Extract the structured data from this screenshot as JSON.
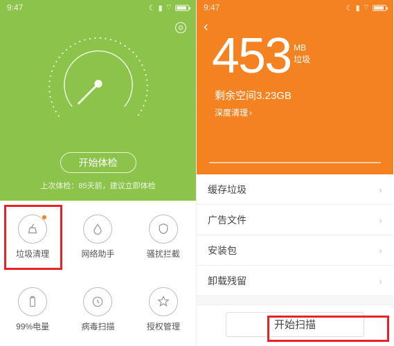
{
  "statusbar": {
    "time": "9:47"
  },
  "left_screen": {
    "start_button": "开始体检",
    "subtext": "上次体检：85天前，建议立即体检",
    "grid": [
      {
        "label": "垃圾清理"
      },
      {
        "label": "网络助手"
      },
      {
        "label": "骚扰拦截"
      },
      {
        "label": "99%电量"
      },
      {
        "label": "病毒扫描"
      },
      {
        "label": "授权管理"
      }
    ]
  },
  "right_screen": {
    "big_number": "453",
    "unit_top": "MB",
    "unit_bottom": "垃圾",
    "freespace": "剩余空间3.23GB",
    "deepclean": "深度清理",
    "list": [
      {
        "label": "缓存垃圾"
      },
      {
        "label": "广告文件"
      },
      {
        "label": "安装包"
      },
      {
        "label": "卸载残留"
      }
    ],
    "scan_button": "开始扫描"
  },
  "colors": {
    "green": "#8cc34a",
    "orange": "#f58220",
    "highlight": "#e62129"
  }
}
